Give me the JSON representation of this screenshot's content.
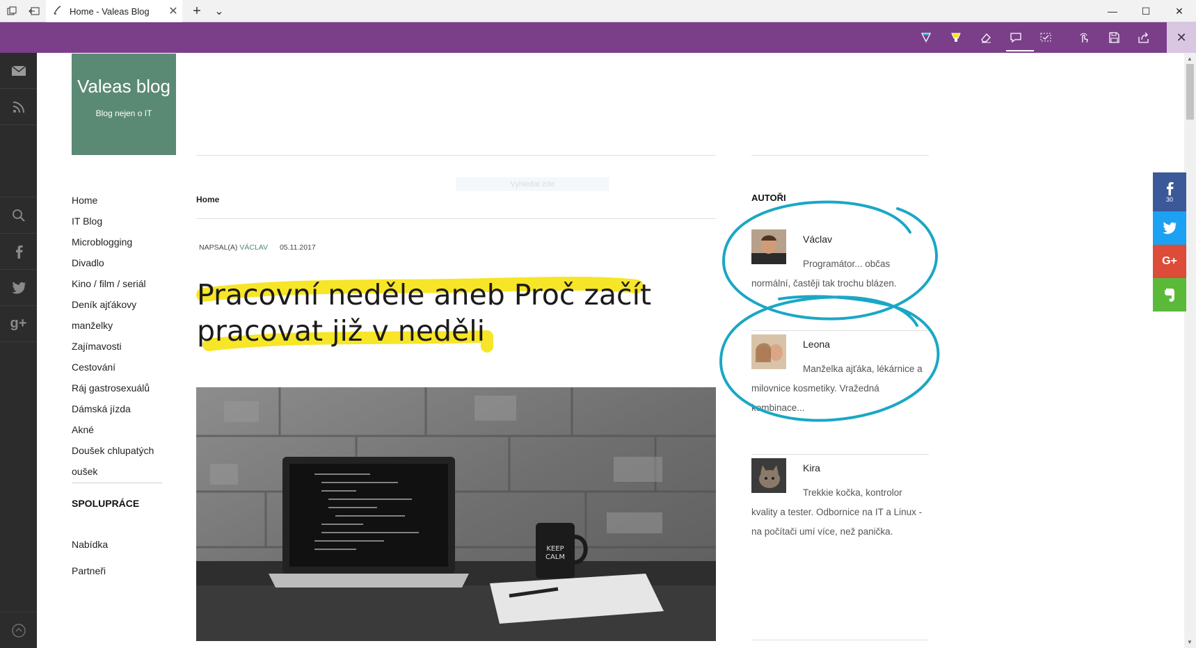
{
  "browser": {
    "tab_title": "Home - Valeas Blog",
    "new_tab_symbol": "+",
    "tab_close_symbol": "✕",
    "tab_list_symbol": "⌄",
    "window_minimize": "—",
    "window_maximize": "☐",
    "window_close": "✕"
  },
  "note_toolbar": {
    "tools": [
      "pen-icon",
      "highlighter-icon",
      "eraser-icon",
      "comment-icon",
      "clip-icon",
      "touch-write-icon",
      "save-icon",
      "share-icon"
    ],
    "exit_symbol": "✕",
    "pen_color": "#1aa7c6",
    "highlighter_color": "#f7e41b"
  },
  "rail": {
    "items": [
      "mail-icon",
      "rss-icon",
      "search-icon",
      "facebook-icon",
      "twitter-icon",
      "google-plus-icon",
      "circle-up-icon"
    ]
  },
  "blog": {
    "title": "Valeas blog",
    "subtitle": "Blog nejen o IT",
    "brand_color": "#5b8a74"
  },
  "nav": {
    "items": [
      "Home",
      "IT Blog",
      "Microblogging",
      "Divadlo",
      "Kino / film / seriál",
      "Deník ajťákovy",
      "manželky",
      "Zajímavosti",
      "Cestování",
      "Ráj gastrosexuálů",
      "Dámská jízda",
      "Akné",
      "Doušek chlupatých",
      "oušek"
    ],
    "coop_heading": "SPOLUPRÁCE",
    "coop_items": [
      "Nabídka",
      "Partneři"
    ]
  },
  "post": {
    "breadcrumb": "Home",
    "author_prefix": "NAPSAL(A)",
    "author": "VÁCLAV",
    "date": "05.11.2017",
    "title_line1": "Pracovní neděle aneb Proč začít",
    "title_line2": "pracovat již v neděli",
    "search_ghost": "Vyhledat zde"
  },
  "sidebar": {
    "heading": "AUTOŘI",
    "authors": [
      {
        "name": "Václav",
        "bio": "Programátor... občas normální, častěji tak trochu blázen."
      },
      {
        "name": "Leona",
        "bio": "Manželka ajťáka, lékárnice a milovnice kosmetiky. Vražedná kombinace..."
      },
      {
        "name": "Kira",
        "bio": "Trekkie kočka, kontrolor kvality a tester. Odbornice na IT a Linux - na počítači umí více, než panička."
      }
    ]
  },
  "share": {
    "facebook_count": "30",
    "colors": {
      "facebook": "#3b5998",
      "twitter": "#1da1f2",
      "google": "#dd4b39",
      "evernote": "#5bb93a"
    },
    "google_label": "G+"
  }
}
